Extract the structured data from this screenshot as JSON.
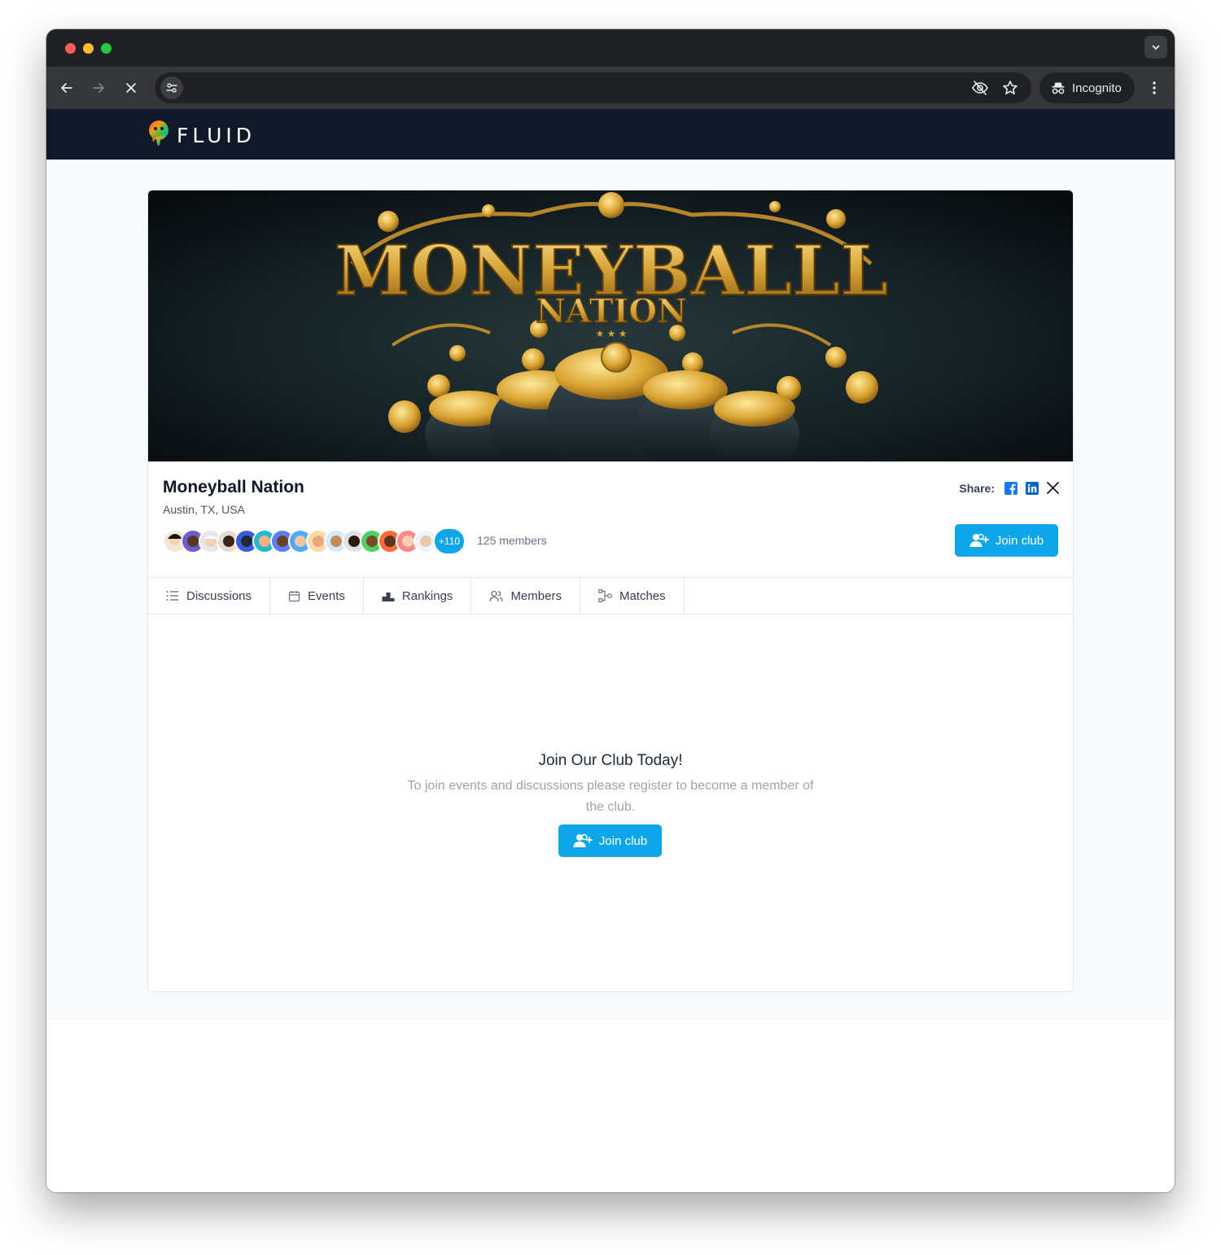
{
  "browser": {
    "incognito_label": "Incognito",
    "url": ""
  },
  "app": {
    "logo_text": "FLUID"
  },
  "club": {
    "banner_line1": "MONEYBALLL",
    "banner_line2": "NATION",
    "name": "Moneyball Nation",
    "location": "Austin, TX, USA",
    "avatar_more": "+110",
    "members_count": "125 members",
    "share_label": "Share:",
    "join_label": "Join club"
  },
  "tabs": [
    {
      "label": "Discussions",
      "icon": "list-icon"
    },
    {
      "label": "Events",
      "icon": "calendar-icon"
    },
    {
      "label": "Rankings",
      "icon": "podium-icon"
    },
    {
      "label": "Members",
      "icon": "users-icon"
    },
    {
      "label": "Matches",
      "icon": "bracket-icon"
    }
  ],
  "cta": {
    "title": "Join Our Club Today!",
    "text": "To join events and discussions please register to become a member of the club.",
    "button_label": "Join club"
  },
  "colors": {
    "accent": "#0ea5e9",
    "appbar": "#111827",
    "facebook": "#1877f2",
    "linkedin": "#0a66c2"
  }
}
